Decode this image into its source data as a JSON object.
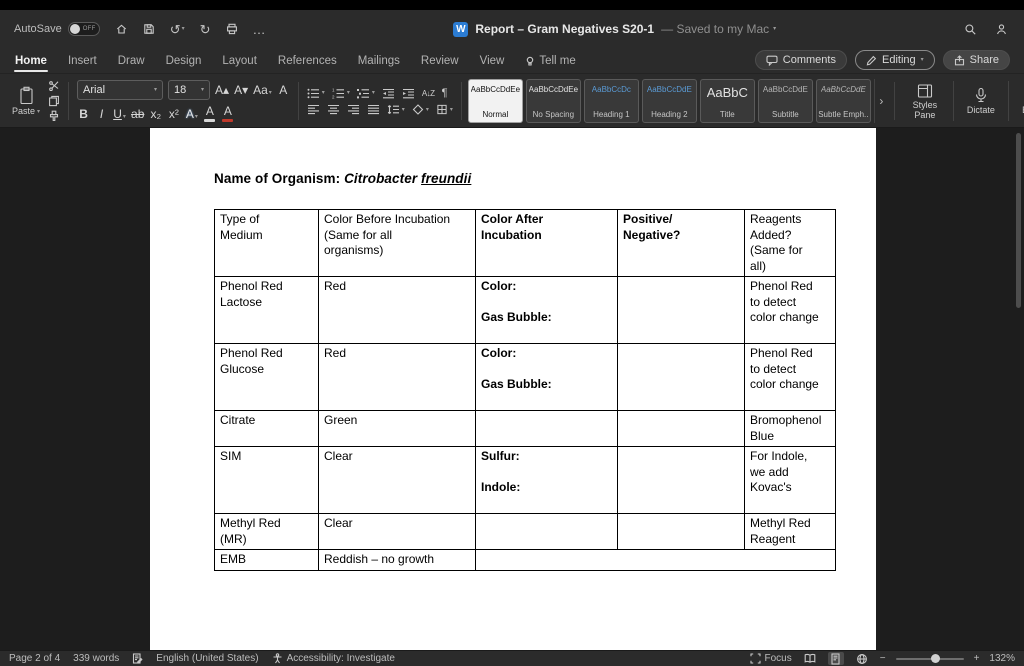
{
  "titlebar": {
    "autosave_label": "AutoSave",
    "autosave_state": "OFF",
    "app_icon_letter": "W",
    "doc_title": "Report – Gram Negatives S20-1",
    "saved_status": "— Saved to my Mac"
  },
  "ribbon_tabs": {
    "tabs": [
      {
        "label": "Home"
      },
      {
        "label": "Insert"
      },
      {
        "label": "Draw"
      },
      {
        "label": "Design"
      },
      {
        "label": "Layout"
      },
      {
        "label": "References"
      },
      {
        "label": "Mailings"
      },
      {
        "label": "Review"
      },
      {
        "label": "View"
      },
      {
        "label": "Tell me"
      }
    ],
    "comments_label": "Comments",
    "editing_label": "Editing",
    "share_label": "Share"
  },
  "ribbon": {
    "paste_label": "Paste",
    "font_family": "Arial",
    "font_size": "18",
    "format": {
      "grow": "A▴",
      "shrink": "A▾",
      "case": "Aa",
      "clear": "A",
      "bold": "B",
      "italic": "I",
      "underline": "U",
      "strike": "ab",
      "subscript": "x₂",
      "superscript": "x²",
      "effects": "A",
      "highlight": "A",
      "fontcolor": "A"
    },
    "styles": [
      {
        "sample": "AaBbCcDdEe",
        "label": "Normal"
      },
      {
        "sample": "AaBbCcDdEe",
        "label": "No Spacing"
      },
      {
        "sample": "AaBbCcDc",
        "label": "Heading 1"
      },
      {
        "sample": "AaBbCcDdE",
        "label": "Heading 2"
      },
      {
        "sample": "AaBbC",
        "label": "Title"
      },
      {
        "sample": "AaBbCcDdE",
        "label": "Subtitle"
      },
      {
        "sample": "AaBbCcDdE",
        "label": "Subtle Emph.."
      }
    ],
    "styles_pane_label": "Styles Pane",
    "dictate_label": "Dictate",
    "editor_label": "Editor"
  },
  "icons": {
    "undo": "↺",
    "redo": "↻",
    "more": "…",
    "chevron": "▾",
    "gallery_more": "›",
    "pilcrow": "¶",
    "sort": "A↓Z",
    "minus": "−",
    "plus": "+"
  },
  "colors": {
    "accent_blue": "#2b7cd3",
    "heading_style_blue": "#5b9bd5",
    "font_color_bar": "#c0392b",
    "highlight_bar": "#d8d8d8"
  },
  "document": {
    "heading": {
      "prefix": "Name of Organism: ",
      "organism_italic": "Citrobacter ",
      "organism_underlined": "freundii"
    },
    "table": {
      "headers": [
        {
          "lines": [
            "Type of",
            "Medium"
          ],
          "bold": false
        },
        {
          "lines": [
            "Color Before Incubation",
            "(Same for all",
            "organisms)"
          ],
          "bold": false
        },
        {
          "lines": [
            "Color After",
            "Incubation"
          ],
          "bold": true
        },
        {
          "lines": [
            "Positive/",
            "Negative?"
          ],
          "bold": true
        },
        {
          "lines": [
            "Reagents",
            "Added?",
            "(Same for",
            "all)"
          ],
          "bold": false
        }
      ],
      "rows": [
        {
          "cells": [
            {
              "lines": [
                "Phenol Red",
                "Lactose"
              ]
            },
            {
              "lines": [
                "Red"
              ]
            },
            {
              "lines": [
                "Color:",
                "",
                "Gas Bubble:",
                ""
              ],
              "bold": true
            },
            {
              "lines": []
            },
            {
              "lines": [
                "Phenol Red",
                "to detect",
                "color change"
              ]
            }
          ]
        },
        {
          "cells": [
            {
              "lines": [
                "Phenol Red",
                "Glucose"
              ]
            },
            {
              "lines": [
                "Red"
              ]
            },
            {
              "lines": [
                "Color:",
                "",
                "Gas Bubble:",
                ""
              ],
              "bold": true
            },
            {
              "lines": []
            },
            {
              "lines": [
                "Phenol Red",
                "to detect",
                "color change"
              ]
            }
          ]
        },
        {
          "cells": [
            {
              "lines": [
                "Citrate"
              ]
            },
            {
              "lines": [
                "Green"
              ]
            },
            {
              "lines": []
            },
            {
              "lines": []
            },
            {
              "lines": [
                "Bromophenol",
                "Blue"
              ]
            }
          ]
        },
        {
          "cells": [
            {
              "lines": [
                "SIM"
              ]
            },
            {
              "lines": [
                "Clear"
              ]
            },
            {
              "lines": [
                "Sulfur:",
                "",
                "Indole:",
                ""
              ],
              "bold": true
            },
            {
              "lines": []
            },
            {
              "lines": [
                "For Indole,",
                "we add",
                "Kovac's"
              ]
            }
          ]
        },
        {
          "cells": [
            {
              "lines": [
                "Methyl Red",
                "(MR)"
              ]
            },
            {
              "lines": [
                "Clear"
              ]
            },
            {
              "lines": []
            },
            {
              "lines": []
            },
            {
              "lines": [
                "Methyl Red",
                "Reagent"
              ]
            }
          ]
        },
        {
          "cells": [
            {
              "lines": [
                "EMB"
              ]
            },
            {
              "lines": [
                "Reddish – no growth"
              ]
            },
            {
              "lines": [],
              "colspan": 3
            }
          ]
        }
      ]
    }
  },
  "statusbar": {
    "page": "Page 2 of 4",
    "words": "339 words",
    "language": "English (United States)",
    "accessibility": "Accessibility: Investigate",
    "focus_label": "Focus",
    "zoom": "132%"
  }
}
